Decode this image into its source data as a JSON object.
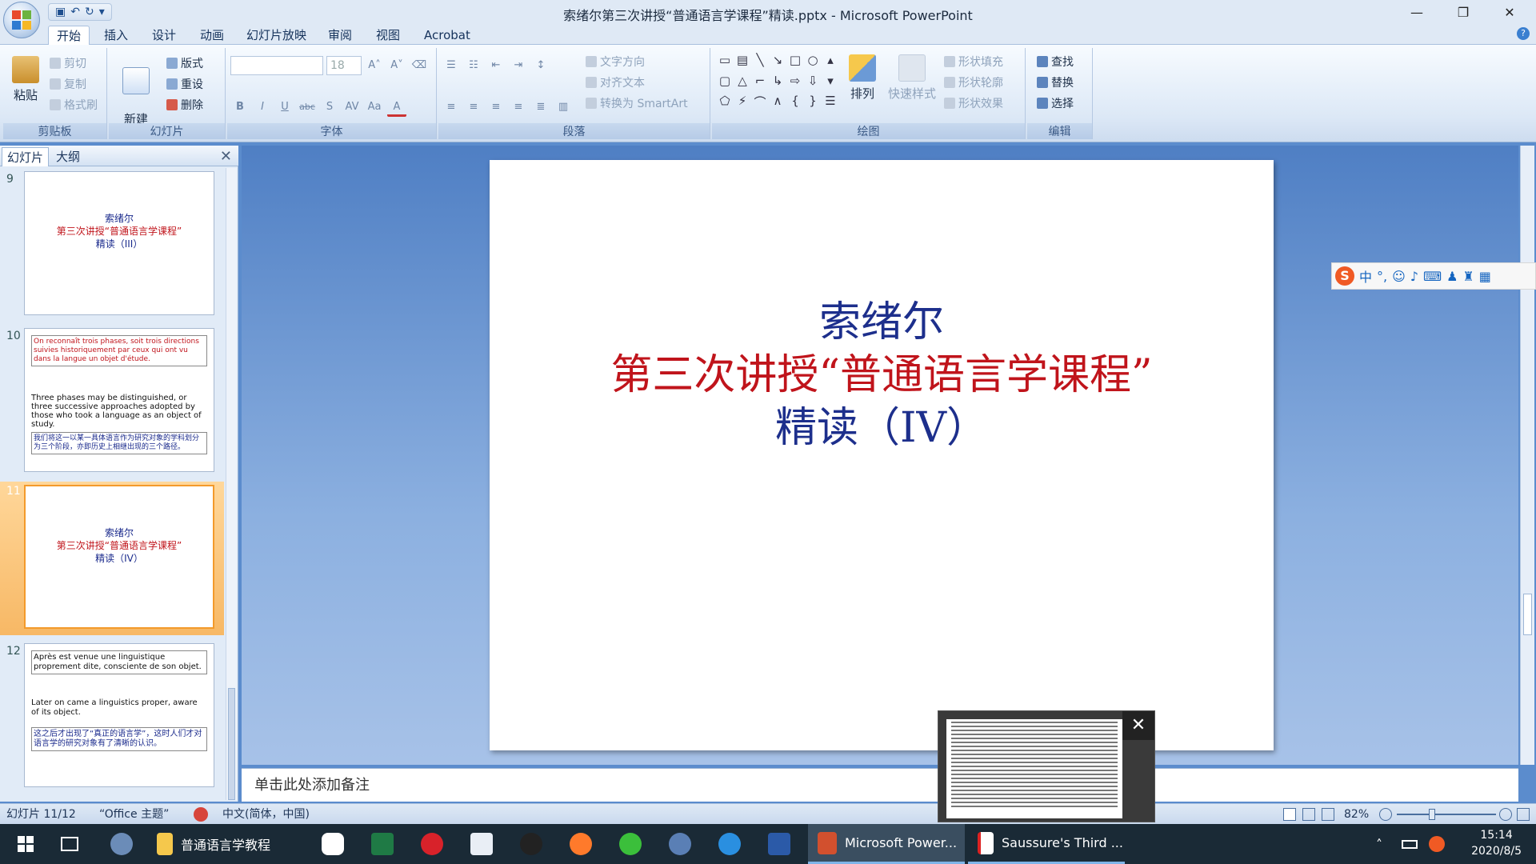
{
  "window": {
    "title": "索绪尔第三次讲授“普通语言学课程”精读.pptx - Microsoft PowerPoint",
    "minimize": "—",
    "restore": "❐",
    "close": "✕"
  },
  "ribbon_tabs": [
    "开始",
    "插入",
    "设计",
    "动画",
    "幻灯片放映",
    "审阅",
    "视图",
    "Acrobat"
  ],
  "clipboard": {
    "paste": "粘贴",
    "cut": "剪切",
    "copy": "复制",
    "format_painter": "格式刷",
    "label": "剪贴板"
  },
  "slides_group": {
    "new_slide": "新建\n幻灯片",
    "layout": "版式",
    "reset": "重设",
    "delete": "删除",
    "label": "幻灯片"
  },
  "font_group": {
    "font_name": "",
    "font_size": "18",
    "label": "字体",
    "bold": "B",
    "italic": "I",
    "underline": "U",
    "strike": "abc",
    "shadow": "S",
    "spacing": "AV",
    "case": "Aa",
    "color": "A"
  },
  "paragraph_group": {
    "text_direction": "文字方向",
    "align_text": "对齐文本",
    "smartart": "转换为 SmartArt",
    "label": "段落"
  },
  "drawing_group": {
    "arrange": "排列",
    "quick_styles": "快速样式",
    "shape_fill": "形状填充",
    "shape_outline": "形状轮廓",
    "shape_effects": "形状效果",
    "label": "绘图"
  },
  "editing_group": {
    "find": "查找",
    "replace": "替换",
    "select": "选择",
    "label": "编辑"
  },
  "pane": {
    "tab_slides": "幻灯片",
    "tab_outline": "大纲",
    "close": "✕"
  },
  "thumbs": [
    {
      "num": "9",
      "line1": "索绪尔",
      "line2": "第三次讲授“普通语言学课程”",
      "line3": "精读（III）"
    },
    {
      "num": "10",
      "t1": "On reconnaît trois phases, soit trois directions suivies historiquement par ceux qui ont vu dans la langue un objet d'étude.",
      "t2": "Three phases may be distinguished, or three successive approaches adopted by those who took a language as an object of study.",
      "t3": "我们将这一以某一具体语言作为研究对象的学科划分为三个阶段，亦即历史上相继出现的三个路径。"
    },
    {
      "num": "11",
      "line1": "索绪尔",
      "line2": "第三次讲授“普通语言学课程”",
      "line3": "精读（IV）"
    },
    {
      "num": "12",
      "t1": "Après est venue une linguistique proprement dite, consciente de son objet.",
      "t2": "Later on came a linguistics proper, aware of its object.",
      "t3": "这之后才出现了“真正的语言学”，这时人们才对语言学的研究对象有了清晰的认识。"
    }
  ],
  "slide": {
    "line1": "索绪尔",
    "line2": "第三次讲授“普通语言学课程”",
    "line3": "精读（IV）"
  },
  "notes_placeholder": "单击此处添加备注",
  "status": {
    "slide_info": "幻灯片 11/12",
    "theme": "“Office 主题”",
    "language": "中文(简体，中国)",
    "zoom": "82%"
  },
  "ime": {
    "mode": "中"
  },
  "taskbar": {
    "folder": "普通语言学教程",
    "ppt": "Microsoft Power...",
    "pdf": "Saussure's Third ...",
    "time": "15:14",
    "date": "2020/8/5"
  },
  "preview": {
    "close": "✕"
  }
}
